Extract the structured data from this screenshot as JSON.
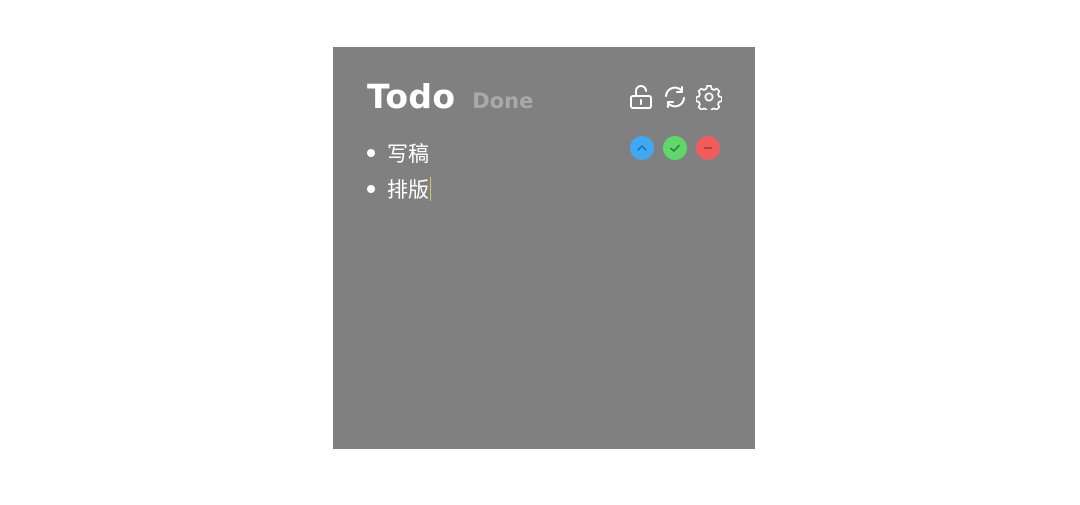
{
  "header": {
    "tab_todo": "Todo",
    "tab_done": "Done"
  },
  "toolbar": {
    "icons": [
      "unlock-icon",
      "refresh-icon",
      "settings-icon"
    ]
  },
  "items": [
    {
      "text": "写稿"
    },
    {
      "text": "排版"
    }
  ],
  "item_actions": {
    "colors": {
      "top": "#3fa9f5",
      "done": "#5fd86a",
      "delete": "#f25b5b"
    },
    "icons": [
      "chevron-up-icon",
      "check-icon",
      "minus-icon"
    ]
  },
  "colors": {
    "panel_bg": "#808080",
    "page_bg": "#ffffff",
    "active_tab": "#ffffff",
    "inactive_tab": "#a9a9a9"
  }
}
